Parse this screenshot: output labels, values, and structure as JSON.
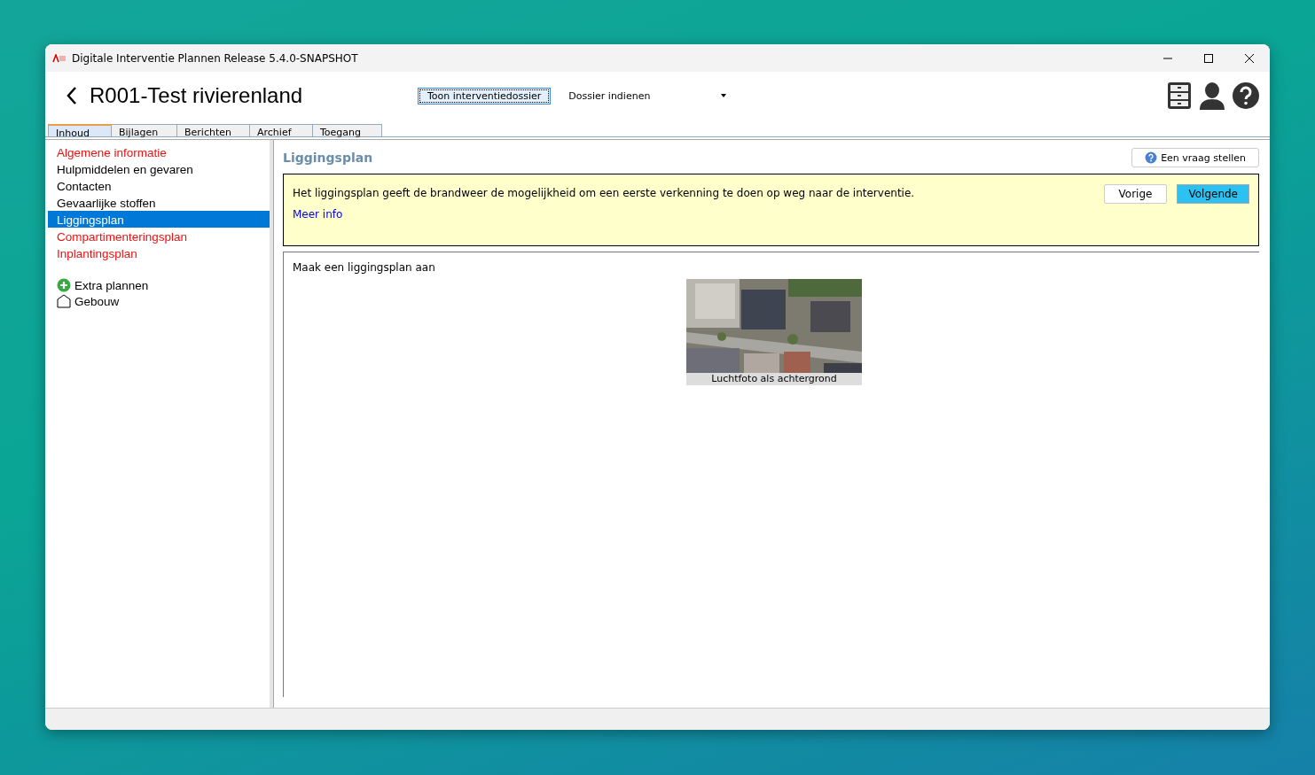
{
  "window": {
    "title": "Digitale Interventie Plannen Release 5.4.0-SNAPSHOT"
  },
  "header": {
    "title": "R001-Test rivierenland",
    "show_button": "Toon interventiedossier",
    "dropdown": "Dossier indienen"
  },
  "tabs": [
    {
      "label": "Inhoud",
      "selected": true
    },
    {
      "label": "Bijlagen",
      "selected": false
    },
    {
      "label": "Berichten",
      "selected": false
    },
    {
      "label": "Archief",
      "selected": false
    },
    {
      "label": "Toegang",
      "selected": false
    }
  ],
  "sidebar": {
    "items": [
      {
        "label": "Algemene informatie",
        "complete": false,
        "selected": false
      },
      {
        "label": "Hulpmiddelen en gevaren",
        "complete": true,
        "selected": false
      },
      {
        "label": "Contacten",
        "complete": true,
        "selected": false
      },
      {
        "label": "Gevaarlijke stoffen",
        "complete": true,
        "selected": false
      },
      {
        "label": "Liggingsplan",
        "complete": true,
        "selected": true
      },
      {
        "label": "Compartimenteringsplan",
        "complete": false,
        "selected": false
      },
      {
        "label": "Inplantingsplan",
        "complete": false,
        "selected": false
      }
    ],
    "extras": [
      {
        "kind": "add",
        "label": "Extra plannen"
      },
      {
        "kind": "building",
        "label": "Gebouw"
      }
    ]
  },
  "content": {
    "title": "Liggingsplan",
    "ask_button": "Een vraag stellen",
    "info": {
      "text": "Het liggingsplan geeft de brandweer de mogelijkheid om een eerste verkenning te doen op weg naar de interventie.",
      "link": "Meer info",
      "prev": "Vorige",
      "next": "Volgende"
    },
    "prompt": "Maak een liggingsplan aan",
    "option": {
      "kind": "picture",
      "caption": "Luchtfoto als achtergrond"
    }
  }
}
